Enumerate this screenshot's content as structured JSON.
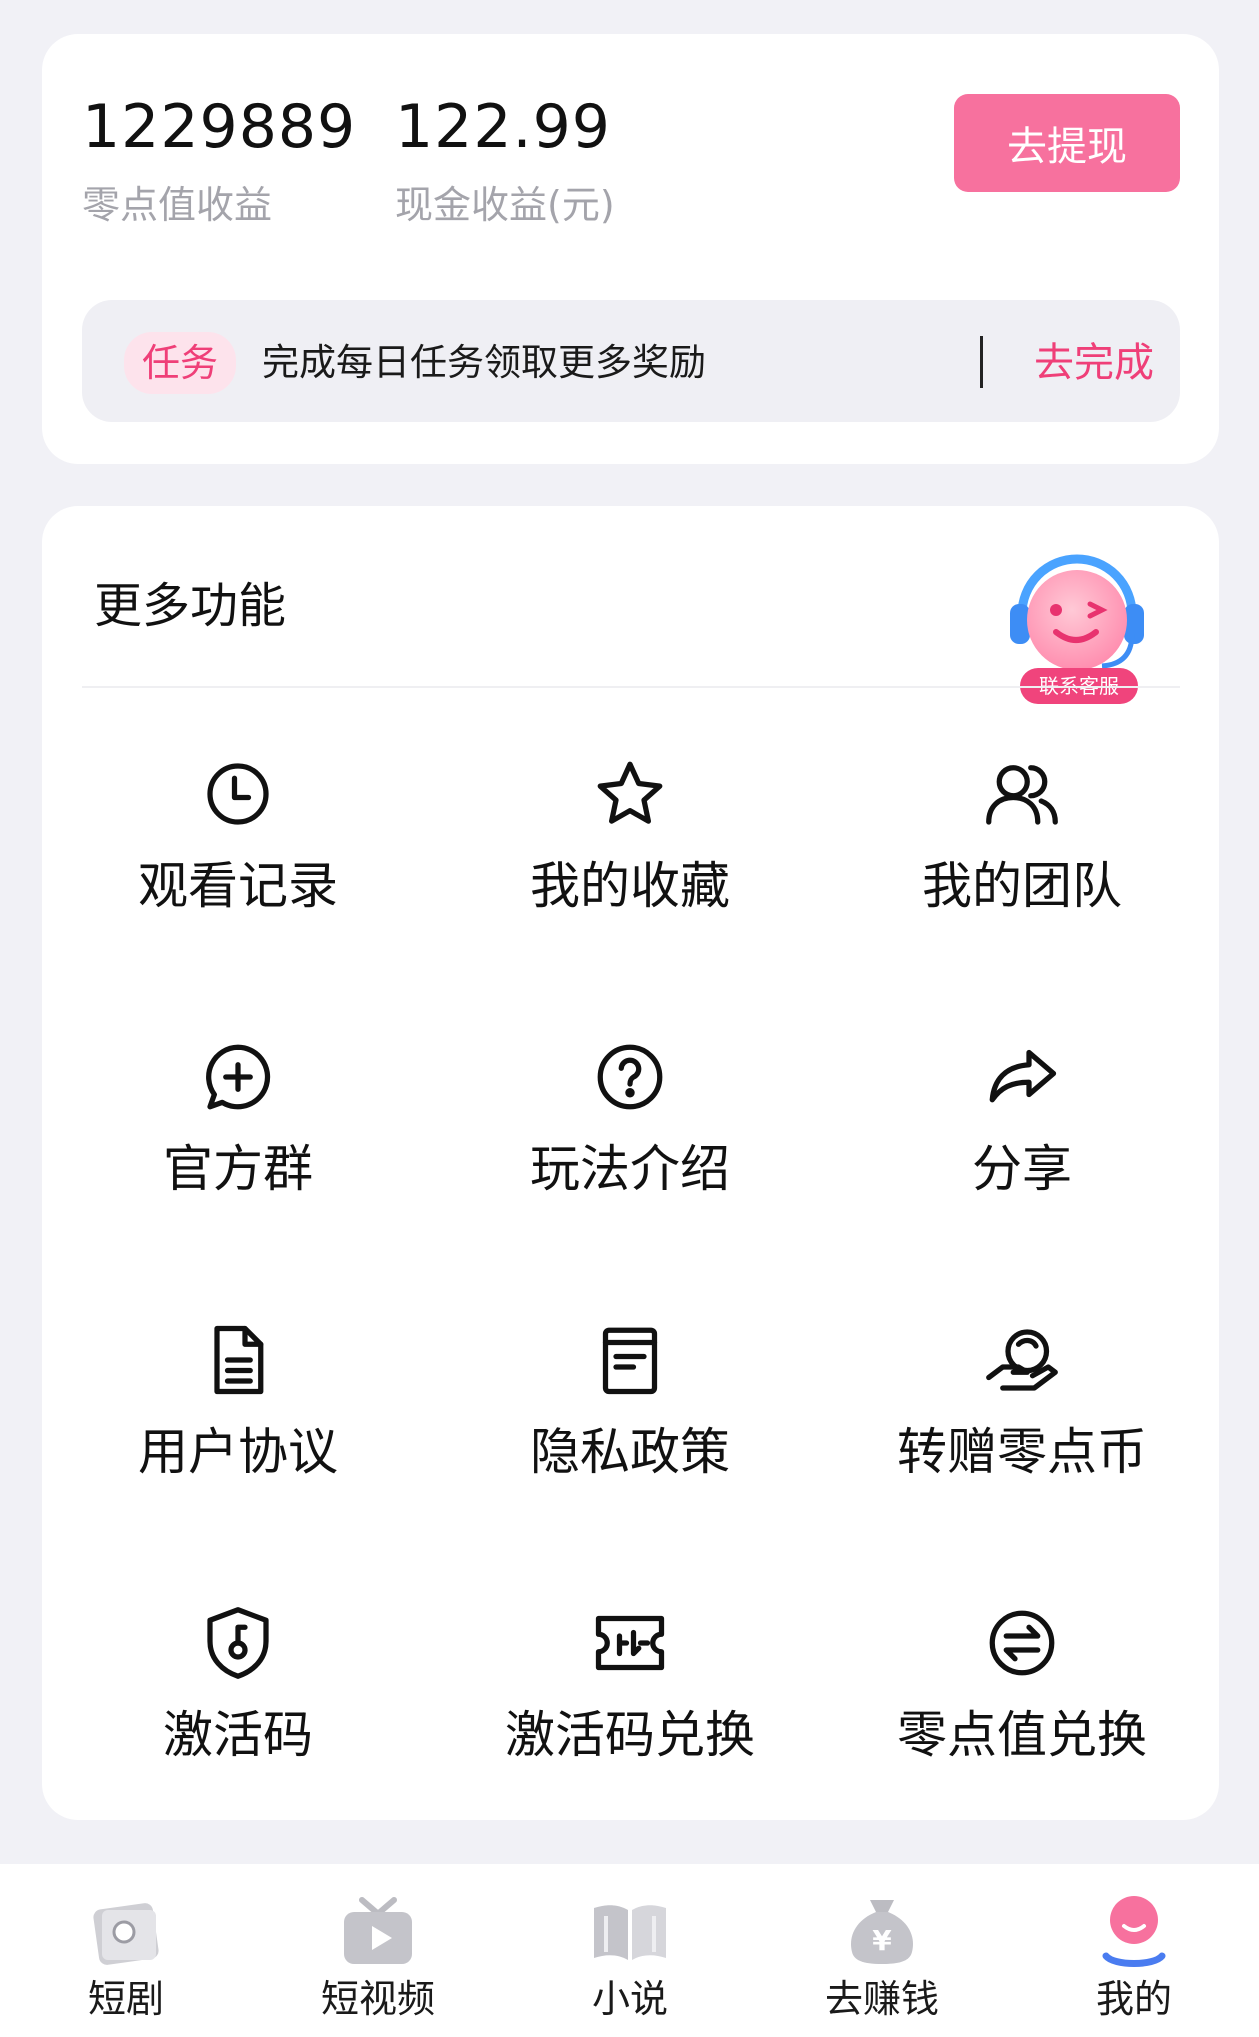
{
  "earnings": {
    "points_value": "1229889",
    "points_label": "零点值收益",
    "cash_value": "122.99",
    "cash_label": "现金收益(元)",
    "withdraw_label": "去提现"
  },
  "task": {
    "tag": "任务",
    "text": "完成每日任务领取更多奖励",
    "action": "去完成"
  },
  "more": {
    "title": "更多功能",
    "service_label": "联系客服",
    "items": [
      {
        "label": "观看记录",
        "icon": "clock-icon"
      },
      {
        "label": "我的收藏",
        "icon": "star-icon"
      },
      {
        "label": "我的团队",
        "icon": "team-icon"
      },
      {
        "label": "官方群",
        "icon": "chat-plus-icon"
      },
      {
        "label": "玩法介绍",
        "icon": "question-icon"
      },
      {
        "label": "分享",
        "icon": "share-icon"
      },
      {
        "label": "用户协议",
        "icon": "document-icon"
      },
      {
        "label": "隐私政策",
        "icon": "policy-icon"
      },
      {
        "label": "转赠零点币",
        "icon": "gift-hand-icon"
      },
      {
        "label": "激活码",
        "icon": "shield-key-icon"
      },
      {
        "label": "激活码兑换",
        "icon": "ticket-icon"
      },
      {
        "label": "零点值兑换",
        "icon": "exchange-icon"
      }
    ]
  },
  "tabs": [
    {
      "label": "短剧",
      "icon": "drama-icon"
    },
    {
      "label": "短视频",
      "icon": "tv-icon"
    },
    {
      "label": "小说",
      "icon": "book-icon"
    },
    {
      "label": "去赚钱",
      "icon": "money-bag-icon"
    },
    {
      "label": "我的",
      "icon": "profile-icon",
      "active": true
    }
  ],
  "colors": {
    "accent": "#f7719e",
    "accent_text": "#ef3f78",
    "muted": "#a4a4ab",
    "background": "#f1f1f6"
  }
}
